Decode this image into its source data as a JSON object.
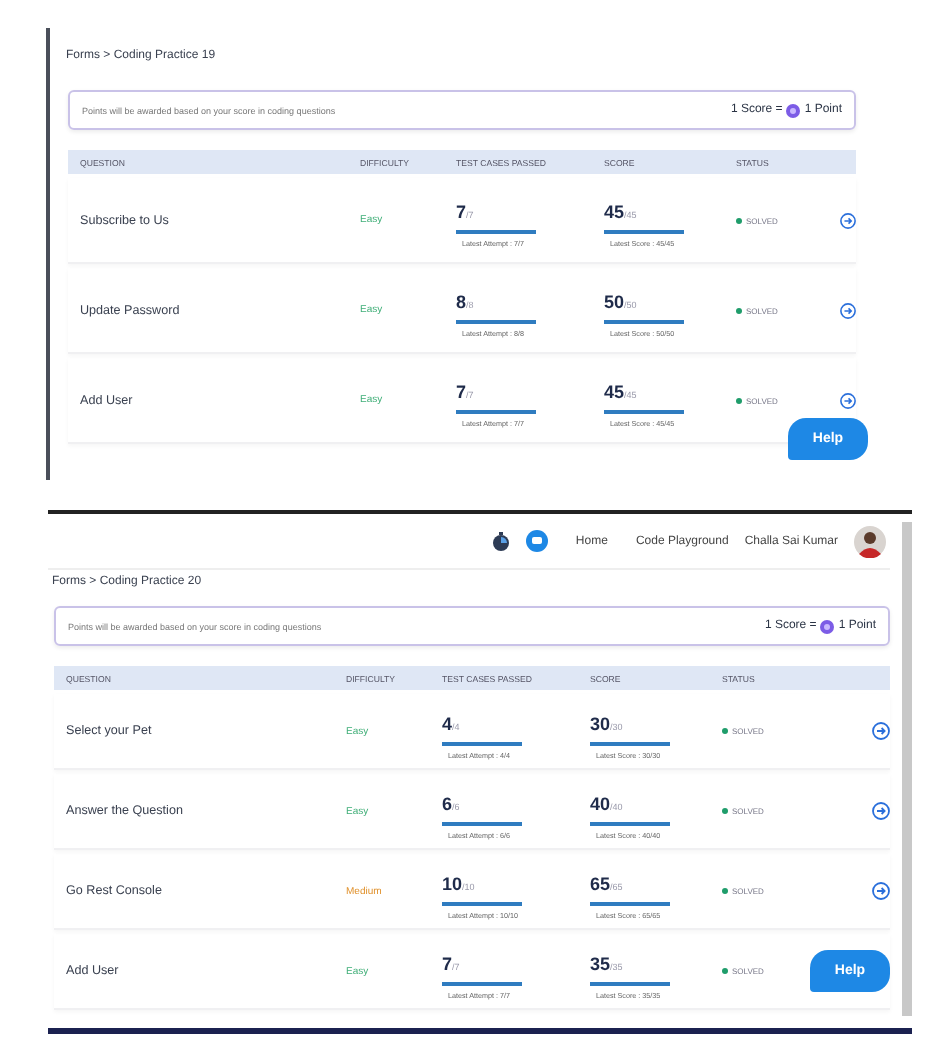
{
  "panels": [
    {
      "breadcrumb": "Forms > Coding Practice 19",
      "info": "Points will be awarded based on your score in coding questions",
      "score_note": {
        "left": "1 Score =",
        "right": "1 Point"
      },
      "columns": [
        "QUESTION",
        "DIFFICULTY",
        "TEST CASES PASSED",
        "SCORE",
        "STATUS"
      ],
      "rows": [
        {
          "question": "Subscribe to Us",
          "difficulty": "Easy",
          "kind": "easy",
          "passed": {
            "value": "7",
            "total": "/7",
            "caption": "Latest Attempt : 7/7"
          },
          "score": {
            "value": "45",
            "total": "/45",
            "caption": "Latest Score : 45/45"
          },
          "status": "SOLVED",
          "color": "#1f9d6b"
        },
        {
          "question": "Update Password",
          "difficulty": "Easy",
          "kind": "easy",
          "passed": {
            "value": "8",
            "total": "/8",
            "caption": "Latest Attempt : 8/8"
          },
          "score": {
            "value": "50",
            "total": "/50",
            "caption": "Latest Score : 50/50"
          },
          "status": "SOLVED",
          "color": "#1f9d6b"
        },
        {
          "question": "Add User",
          "difficulty": "Easy",
          "kind": "easy",
          "passed": {
            "value": "7",
            "total": "/7",
            "caption": "Latest Attempt : 7/7"
          },
          "score": {
            "value": "45",
            "total": "/45",
            "caption": "Latest Score : 45/45"
          },
          "status": "SOLVED",
          "color": "#1f9d6b"
        }
      ],
      "help": "Help"
    },
    {
      "header": {
        "links": [
          "Home",
          "Code Playground"
        ],
        "user": "Challa Sai Kumar"
      },
      "breadcrumb": "Forms > Coding Practice 20",
      "info": "Points will be awarded based on your score in coding questions",
      "score_note": {
        "left": "1 Score =",
        "right": "1 Point"
      },
      "columns": [
        "QUESTION",
        "DIFFICULTY",
        "TEST CASES PASSED",
        "SCORE",
        "STATUS"
      ],
      "rows": [
        {
          "question": "Select your Pet",
          "difficulty": "Easy",
          "kind": "easy",
          "passed": {
            "value": "4",
            "total": "/4",
            "caption": "Latest Attempt : 4/4"
          },
          "score": {
            "value": "30",
            "total": "/30",
            "caption": "Latest Score : 30/30"
          },
          "status": "SOLVED",
          "color": "#1f9d6b"
        },
        {
          "question": "Answer the Question",
          "difficulty": "Easy",
          "kind": "easy",
          "passed": {
            "value": "6",
            "total": "/6",
            "caption": "Latest Attempt : 6/6"
          },
          "score": {
            "value": "40",
            "total": "/40",
            "caption": "Latest Score : 40/40"
          },
          "status": "SOLVED",
          "color": "#1f9d6b"
        },
        {
          "question": "Go Rest Console",
          "difficulty": "Medium",
          "kind": "medium",
          "passed": {
            "value": "10",
            "total": "/10",
            "caption": "Latest Attempt : 10/10"
          },
          "score": {
            "value": "65",
            "total": "/65",
            "caption": "Latest Score : 65/65"
          },
          "status": "SOLVED",
          "color": "#1f9d6b"
        },
        {
          "question": "Add User",
          "difficulty": "Easy",
          "kind": "easy",
          "passed": {
            "value": "7",
            "total": "/7",
            "caption": "Latest Attempt : 7/7"
          },
          "score": {
            "value": "35",
            "total": "/35",
            "caption": "Latest Score : 35/35"
          },
          "status": "SOLVED",
          "color": "#1f9d6b"
        }
      ],
      "help": "Help",
      "help_over_last_row": true
    }
  ]
}
